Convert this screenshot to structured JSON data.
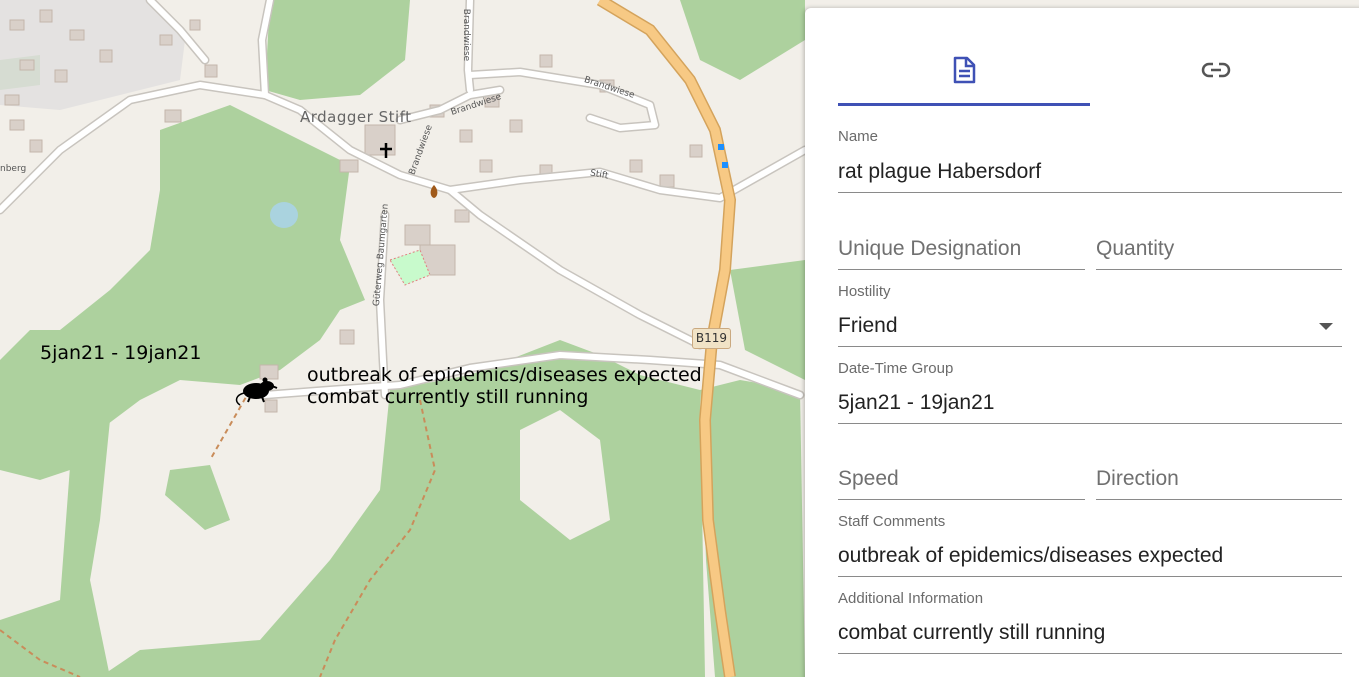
{
  "map": {
    "place_label": "Ardagger Stift",
    "street_labels": {
      "brandwiese_1": "Brandwiese",
      "brandwiese_2": "Brandwiese",
      "brandwiese_3": "Brandwiese",
      "brandwiese_4": "Brandwiese",
      "stift": "Stift",
      "guterweg": "Güterweg Baumgarten",
      "left_edge": "nberg"
    },
    "road_shield": "B119",
    "symbol": {
      "icon": "rat-icon",
      "date_label": "5jan21 - 19jan21",
      "comment_line1": "outbreak of epidemics/diseases expected",
      "comment_line2": "combat currently still running"
    }
  },
  "panel": {
    "tabs": [
      {
        "icon": "document-icon",
        "active": true
      },
      {
        "icon": "link-icon",
        "active": false
      }
    ],
    "fields": {
      "name": {
        "label": "Name",
        "value": "rat plague Habersdorf"
      },
      "unique_designation": {
        "placeholder": "Unique Designation"
      },
      "quantity": {
        "placeholder": "Quantity"
      },
      "hostility": {
        "label": "Hostility",
        "value": "Friend"
      },
      "dtg": {
        "label": "Date-Time Group",
        "value": "5jan21 - 19jan21"
      },
      "speed": {
        "placeholder": "Speed"
      },
      "direction": {
        "placeholder": "Direction"
      },
      "staff_comments": {
        "label": "Staff Comments",
        "value": "outbreak of epidemics/diseases expected"
      },
      "additional_information": {
        "label": "Additional Information",
        "value": "combat currently still running"
      }
    }
  },
  "colors": {
    "accent": "#3f51b5",
    "forest": "#add19e",
    "land": "#f2efe9",
    "trunk_road": "#f7c984"
  }
}
